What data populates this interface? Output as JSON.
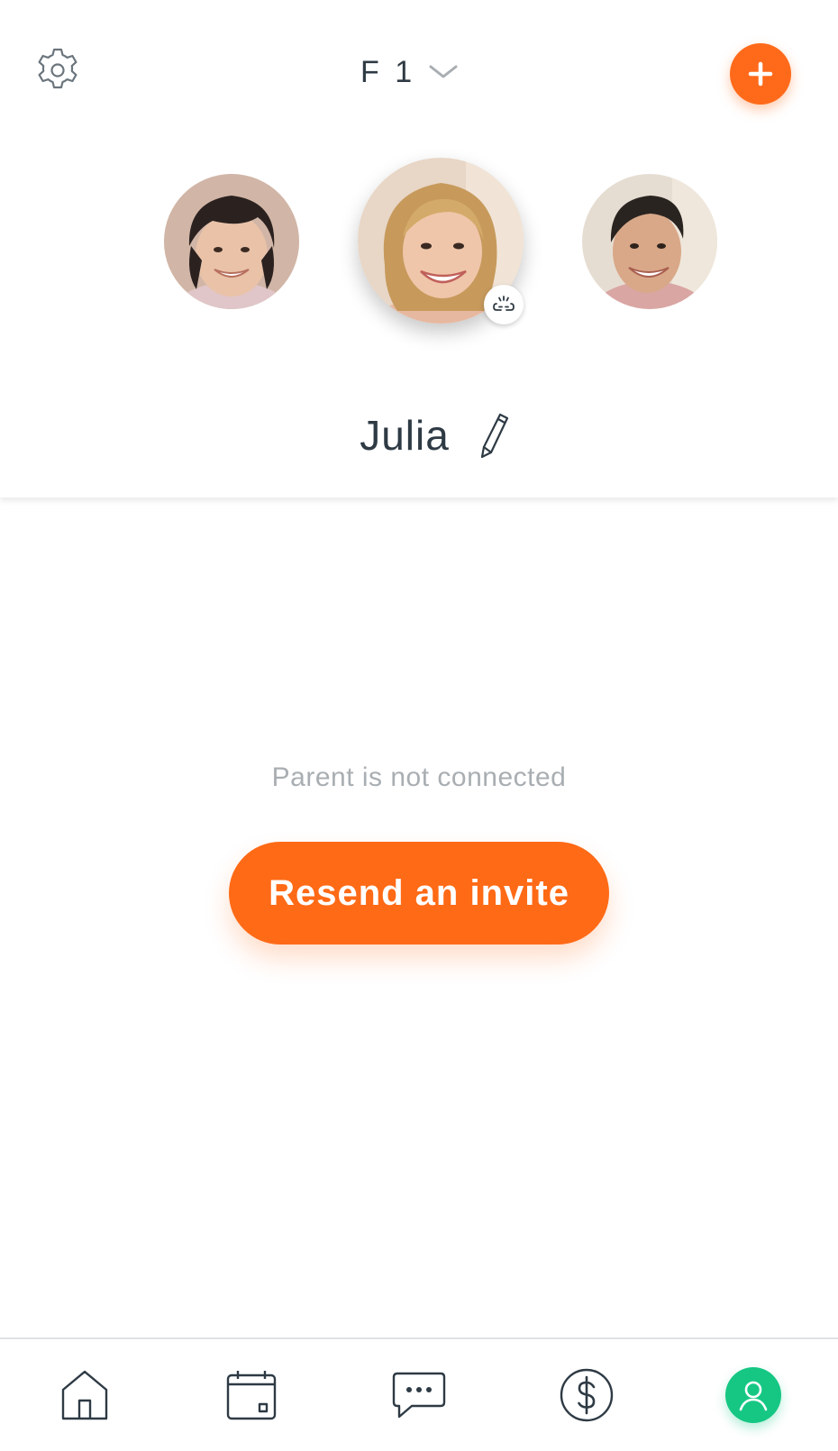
{
  "header": {
    "settings_icon": "gear-icon",
    "family_label": "F 1",
    "family_dropdown_icon": "chevron-down-icon",
    "add_icon": "plus-icon"
  },
  "members": [
    {
      "role": "child",
      "selected": false
    },
    {
      "role": "parent",
      "selected": true,
      "badge_icon": "unlink-icon"
    },
    {
      "role": "parent",
      "selected": false
    }
  ],
  "profile": {
    "name": "Julia",
    "edit_icon": "pencil-icon"
  },
  "content": {
    "status_text": "Parent is not connected",
    "resend_label": "Resend an invite"
  },
  "bottom_nav": {
    "items": [
      {
        "icon": "home-icon",
        "active": false
      },
      {
        "icon": "calendar-icon",
        "active": false
      },
      {
        "icon": "chat-icon",
        "active": false
      },
      {
        "icon": "dollar-icon",
        "active": false
      },
      {
        "icon": "profile-icon",
        "active": true
      }
    ]
  },
  "colors": {
    "accent_orange": "#ff6a16",
    "active_green": "#16c784",
    "text_dark": "#2e3a44",
    "text_muted": "#a9aeb2"
  }
}
